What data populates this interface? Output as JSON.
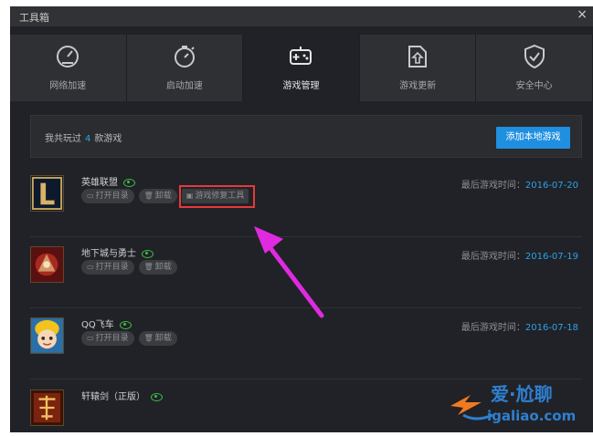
{
  "window": {
    "title": "工具箱",
    "close_glyph": "×"
  },
  "tabs": [
    {
      "label": "网络加速",
      "icon": "speedometer-icon",
      "active": false
    },
    {
      "label": "启动加速",
      "icon": "stopwatch-icon",
      "active": false
    },
    {
      "label": "游戏管理",
      "icon": "gamepad-icon",
      "active": true
    },
    {
      "label": "游戏更新",
      "icon": "update-icon",
      "active": false
    },
    {
      "label": "安全中心",
      "icon": "shield-check-icon",
      "active": false
    }
  ],
  "summary": {
    "prefix": "我共玩过",
    "count": "4",
    "suffix": "款游戏",
    "add_button": "添加本地游戏"
  },
  "games": [
    {
      "name": "英雄联盟",
      "open_label": "打开目录",
      "uninstall_label": "卸载",
      "repair_label": "游戏修复工具",
      "last_played_label": "最后游戏时间：",
      "last_played": "2016-07-20"
    },
    {
      "name": "地下城与勇士",
      "open_label": "打开目录",
      "uninstall_label": "卸载",
      "last_played_label": "最后游戏时间：",
      "last_played": "2016-07-19"
    },
    {
      "name": "QQ飞车",
      "open_label": "打开目录",
      "uninstall_label": "卸载",
      "last_played_label": "最后游戏时间：",
      "last_played": "2016-07-18"
    },
    {
      "name": "轩辕剑（正版）"
    }
  ],
  "watermark": {
    "brand": "爱·尬聊",
    "domain": "igaliao.com"
  },
  "colors": {
    "accent": "#1f8fe0",
    "link_blue": "#2ea2e8",
    "eye_green": "#3fbe3f",
    "highlight_red": "#e53a3a",
    "arrow_magenta": "#e02ae0"
  }
}
